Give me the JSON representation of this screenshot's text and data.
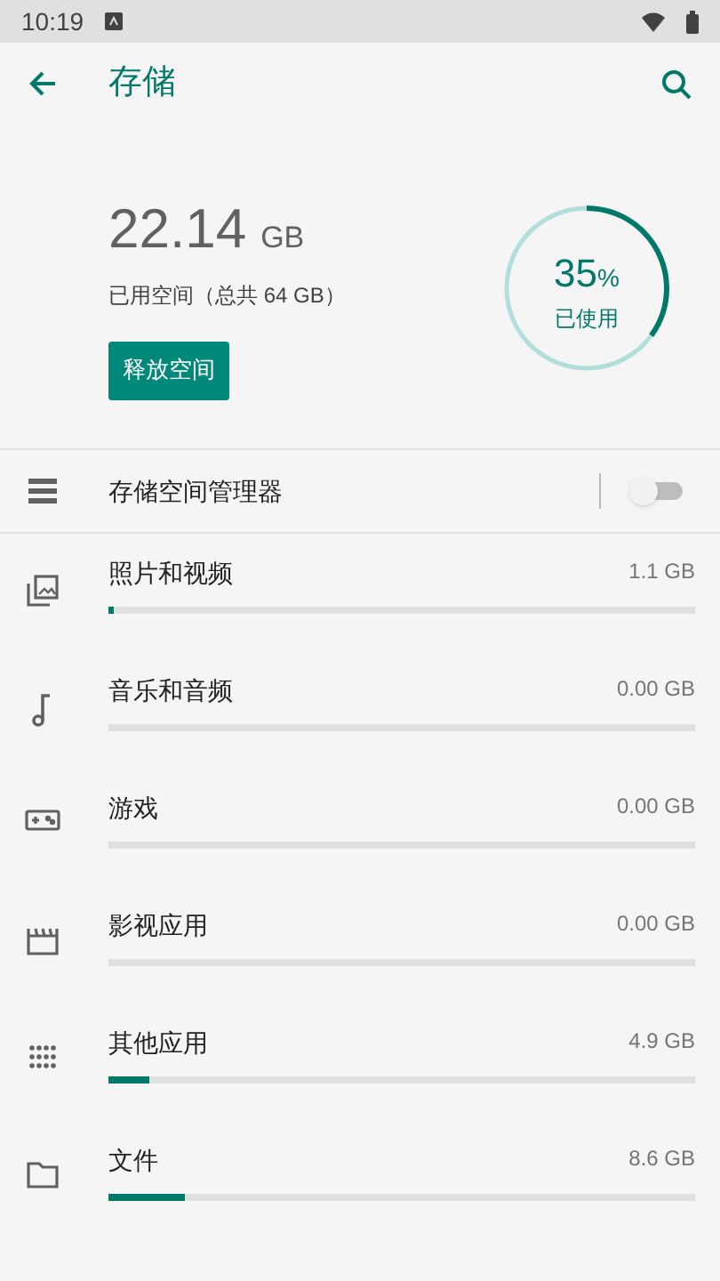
{
  "status_bar": {
    "time": "10:19"
  },
  "app_bar": {
    "title": "存储"
  },
  "summary": {
    "used": "22.14",
    "unit": "GB",
    "caption": "已用空间（总共 64 GB）",
    "button": "释放空间",
    "percent": "35",
    "percent_sign": "%",
    "percent_caption": "已使用",
    "level": 0.35
  },
  "manager": {
    "label": "存储空间管理器",
    "on": false
  },
  "categories": [
    {
      "kind": "photos",
      "label": "照片和视频",
      "size": "1.1 GB",
      "level": 0.01
    },
    {
      "kind": "music",
      "label": "音乐和音频",
      "size": "0.00 GB"
    },
    {
      "kind": "games",
      "label": "游戏",
      "size": "0.00 GB"
    },
    {
      "kind": "movies",
      "label": "影视应用",
      "size": "0.00 GB"
    },
    {
      "kind": "apps",
      "label": "其他应用",
      "size": "4.9 GB",
      "level": 0.07
    },
    {
      "kind": "files",
      "label": "文件",
      "size": "8.6 GB",
      "level": 0.13
    }
  ]
}
